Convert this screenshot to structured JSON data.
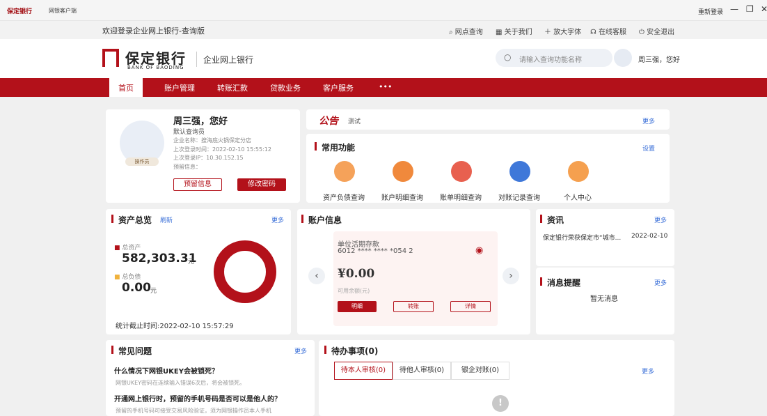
{
  "titlebar": {
    "logo": "保定银行",
    "tab": "网银客户端",
    "relogin": "重新登录",
    "min": "—",
    "max": "❐",
    "close": "✕"
  },
  "topbar": {
    "welcome": "欢迎登录企业网上银行-查询版",
    "links": [
      "网点查询",
      "关于我们",
      "放大字体",
      "在线客服",
      "安全退出"
    ]
  },
  "header": {
    "logo_cn": "保定银行",
    "logo_en": "BANK OF BAODING",
    "logo_sub": "企业网上银行",
    "search_placeholder": "请输入查询功能名称",
    "greeting": "周三强，您好"
  },
  "nav": [
    "首页",
    "账户管理",
    "转账汇款",
    "贷款业务",
    "客户服务",
    "•••"
  ],
  "profile": {
    "name": "周三强，您好",
    "role": "默认查询员",
    "company": "企业名称：搜海底火锅保定分店",
    "last_login": "上次登录时间：2022-02-10 15:55:12",
    "last_ip": "上次登录IP：10.30.152.15",
    "reserve": "预留信息：",
    "avatar_tag": "操作员",
    "btn_reserve": "预留信息",
    "btn_pwd": "修改密码"
  },
  "notice": {
    "title": "公告",
    "text": "测试",
    "more": "更多"
  },
  "common": {
    "title": "常用功能",
    "setting": "设置",
    "items": [
      "资产负债查询",
      "账户明细查询",
      "账单明细查询",
      "对账记录查询",
      "个人中心"
    ],
    "colors": [
      "#f5a25a",
      "#f0893c",
      "#e8604f",
      "#3f78d9",
      "#f5a04f"
    ]
  },
  "assets": {
    "title": "资产总览",
    "refresh": "刷新",
    "more": "更多",
    "total_label": "总资产",
    "total": "582,303.31",
    "unit": "元",
    "debt_label": "总负债",
    "debt": "0.00",
    "debt_unit": "元",
    "time": "统计截止时间:2022-02-10 15:57:29"
  },
  "account": {
    "title": "账户信息",
    "type": "单位活期存款",
    "number": "6012 **** **** *054 2",
    "balance": "¥0.00",
    "avail": "可用余额(元)",
    "btn_detail": "明细",
    "btn_transfer": "转账",
    "btn_info": "详情"
  },
  "news": {
    "title": "资讯",
    "more": "更多",
    "item": "保定银行荣获保定市“城市...",
    "date": "2022-02-10"
  },
  "msg": {
    "title": "消息提醒",
    "more": "更多",
    "empty": "暂无消息"
  },
  "faq": {
    "title": "常见问题",
    "more": "更多",
    "q1": "什么情况下网银UKEY会被锁死？",
    "a1": "网银UKEY密码在连续输入错误6次后，将会被锁死。",
    "q2": "开通网上银行时，预留的手机号码是否可以是他人的？",
    "a2": "预留的手机号码可接受交易风险验证，须为网银操作员本人手机"
  },
  "todo": {
    "title": "待办事项(0)",
    "tabs": [
      "待本人审核(0)",
      "待他人审核(0)",
      "银企对账(0)"
    ],
    "more": "更多",
    "empty_icon": "!"
  }
}
